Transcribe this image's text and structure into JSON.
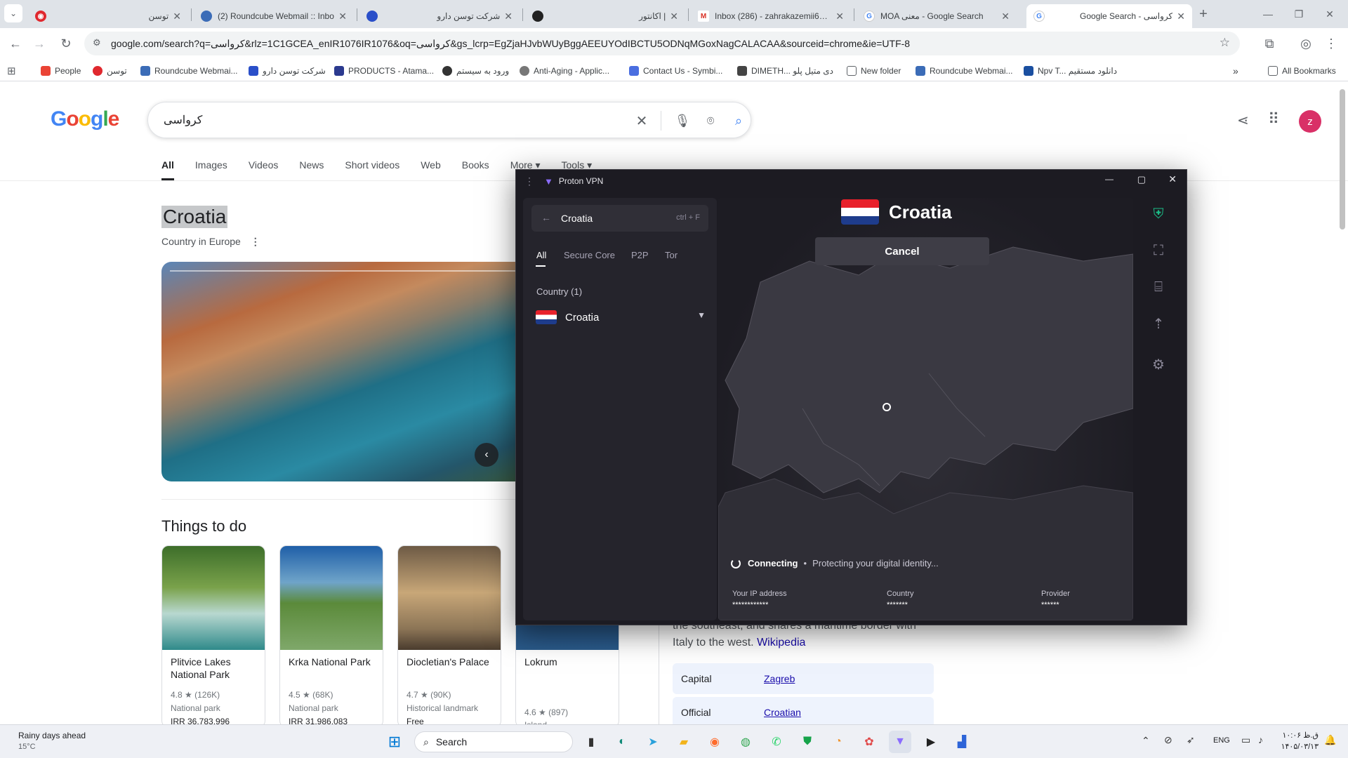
{
  "tabs": [
    {
      "title": "توسن",
      "favicon_color": "#e0282e",
      "active": false
    },
    {
      "title": "(2) Roundcube Webmail :: Inbo",
      "favicon_color": "#3b6cb7",
      "active": false
    },
    {
      "title": "شرکت توسن دارو",
      "favicon_color": "#2a4fc9",
      "active": false
    },
    {
      "title": "اکانتور |",
      "favicon_color": "#222222",
      "active": false
    },
    {
      "title": "Inbox (286) - zahrakazemii65@",
      "favicon_color": "#d93025",
      "active": false
    },
    {
      "title": "MOA معنی - Google Search",
      "favicon_color": "#4285f4",
      "active": false
    },
    {
      "title": "Google Search - کرواسی",
      "favicon_color": "#4285f4",
      "active": true
    }
  ],
  "address_bar": {
    "url": "google.com/search?q=کرواسی&rlz=1C1GCEA_enIR1076IR1076&oq=کرواسی&gs_lcrp=EgZjaHJvbWUyBggAEEUYOdIBCTU5ODNqMGoxNagCALACAA&sourceid=chrome&ie=UTF-8"
  },
  "bookmarks": [
    {
      "label": "People",
      "color": "#ea4335"
    },
    {
      "label": "توسن",
      "color": "#e0282e"
    },
    {
      "label": "Roundcube Webmai...",
      "color": "#3b6cb7"
    },
    {
      "label": "شرکت توسن دارو",
      "color": "#2a4fc9"
    },
    {
      "label": "PRODUCTS - Atama...",
      "color": "#2b3a8f"
    },
    {
      "label": "ورود به سیستم",
      "color": "#333333"
    },
    {
      "label": "Anti-Aging - Applic...",
      "color": "#777777"
    },
    {
      "label": "Contact Us - Symbi...",
      "color": "#4a6ee0"
    },
    {
      "label": "DIMETH... دی متیل پلو",
      "color": "#444444"
    },
    {
      "label": "New folder",
      "color": "#5f6368"
    },
    {
      "label": "Roundcube Webmai...",
      "color": "#3b6cb7"
    },
    {
      "label": "Npv T... دانلود مستقیم",
      "color": "#1a4fa0"
    }
  ],
  "bookmarks_all": "All Bookmarks",
  "google": {
    "logo": "Google",
    "query": "کرواسی",
    "avatar_letter": "z",
    "search_tabs": [
      "All",
      "Images",
      "Videos",
      "News",
      "Short videos",
      "Web",
      "Books",
      "More",
      "Tools"
    ],
    "kp_title": "Croatia",
    "kp_subtitle": "Country in Europe",
    "things_heading": "Things to do",
    "cards": [
      {
        "name": "Plitvice Lakes National Park",
        "rating": "4.8 ★ (126K)",
        "type": "National park",
        "price": "IRR 36,783,996"
      },
      {
        "name": "Krka National Park",
        "rating": "4.5 ★ (68K)",
        "type": "National park",
        "price": "IRR 31,986,083"
      },
      {
        "name": "Diocletian's Palace",
        "rating": "4.7 ★ (90K)",
        "type": "Historical landmark",
        "price": "Free"
      },
      {
        "name": "Lokrum",
        "rating": "4.6 ★ (897)",
        "type": "Island",
        "price": ""
      }
    ],
    "wiki_text": "the southeast, and shares a maritime border with Italy to the west.",
    "wiki_link": "Wikipedia",
    "facts": [
      {
        "key": "Capital",
        "value": "Zagreb"
      },
      {
        "key": "Official",
        "value": "Croatian"
      }
    ]
  },
  "vpn": {
    "app_title": "Proton VPN",
    "search_value": "Croatia",
    "shortcut": "ctrl + F",
    "filter_tabs": [
      "All",
      "Secure Core",
      "P2P",
      "Tor"
    ],
    "section_header": "Country (1)",
    "country": "Croatia",
    "connect_country": "Croatia",
    "cancel_label": "Cancel",
    "status": "Connecting",
    "status_detail": "Protecting your digital identity...",
    "ip_label": "Your IP address",
    "ip_value": "************",
    "country_label": "Country",
    "country_value": "*******",
    "provider_label": "Provider",
    "provider_value": "******"
  },
  "taskbar": {
    "weather_line1": "Rainy days ahead",
    "weather_line2": "15°C",
    "search_label": "Search",
    "lang": "ENG",
    "time": "۱۰:۰۶ ق.ظ",
    "date": "۱۴۰۵/۰۳/۱۳"
  }
}
